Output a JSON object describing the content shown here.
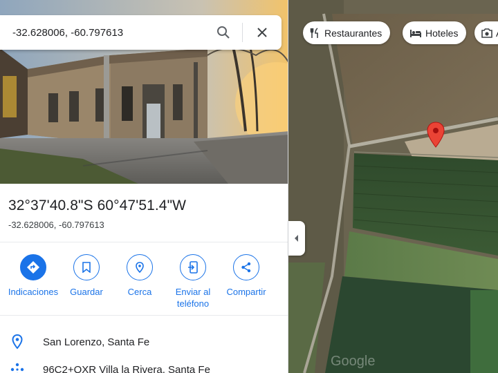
{
  "search": {
    "value": "-32.628006, -60.797613"
  },
  "place": {
    "title": "32°37'40.8\"S 60°47'51.4\"W",
    "coordinates": "-32.628006, -60.797613"
  },
  "actions": [
    {
      "label": "Indicaciones",
      "icon": "directions-icon"
    },
    {
      "label": "Guardar",
      "icon": "bookmark-icon"
    },
    {
      "label": "Cerca",
      "icon": "nearby-icon"
    },
    {
      "label": "Enviar al teléfono",
      "icon": "send-to-phone-icon"
    },
    {
      "label": "Compartir",
      "icon": "share-icon"
    }
  ],
  "info": [
    {
      "text": "San Lorenzo, Santa Fe",
      "icon": "location-pin-icon"
    },
    {
      "text": "96C2+QXR Villa la Rivera, Santa Fe",
      "icon": "plus-code-icon"
    }
  ],
  "chips": [
    {
      "label": "Restaurantes",
      "icon": "restaurant-icon"
    },
    {
      "label": "Hoteles",
      "icon": "hotel-icon"
    },
    {
      "label": "A",
      "icon": "camera-icon"
    }
  ],
  "map": {
    "watermark": "Google"
  },
  "colors": {
    "accent": "#1a73e8",
    "marker": "#ea4335"
  }
}
